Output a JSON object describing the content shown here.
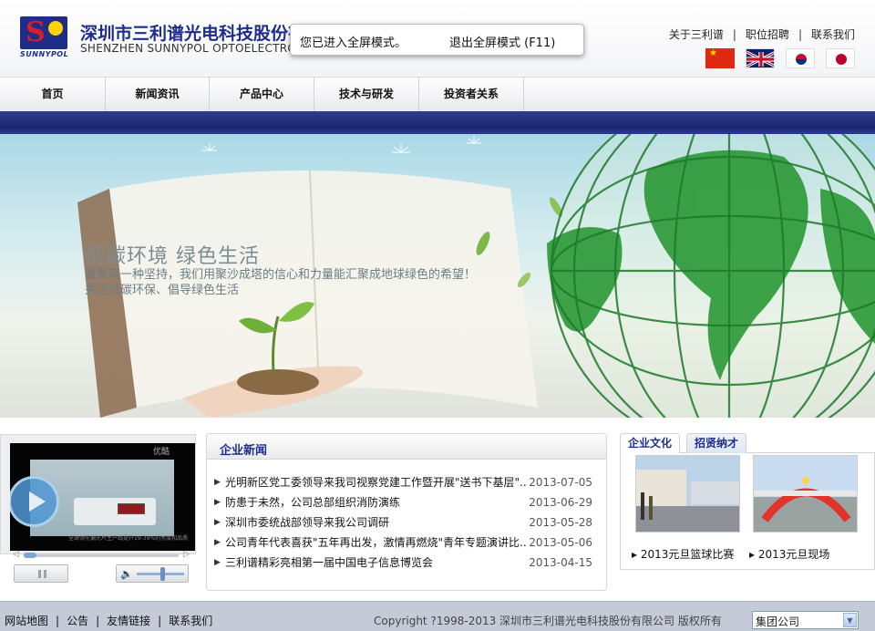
{
  "header": {
    "logo_text": "SUNNYPOL",
    "company_cn": "深圳市三利谱光电科技股份有",
    "company_en": "SHENZHEN SUNNYPOL OPTOELECTRON",
    "links": [
      "关于三利谱",
      "职位招聘",
      "联系我们"
    ],
    "flags": [
      "china-flag-icon",
      "uk-flag-icon",
      "korea-flag-icon",
      "japan-flag-icon"
    ]
  },
  "fullscreen_toast": {
    "message": "您已进入全屏模式。",
    "exit_label": "退出全屏模式 (F11)"
  },
  "nav": {
    "items": [
      "首页",
      "新闻资讯",
      "产品中心",
      "技术与研发",
      "投资者关系"
    ]
  },
  "banner": {
    "title": "低碳环境  绿色生活",
    "line1": "凝聚每一种坚持，我们用聚沙成塔的信心和力量能汇聚成地球绿色的希望！",
    "line2": "关注低碳环保、倡导绿色生活"
  },
  "video": {
    "brand": "优酷",
    "caption": "全球领先偏光片生产线提升19-39%的亮度和品质"
  },
  "news": {
    "title": "企业新闻",
    "items": [
      {
        "text": "光明新区党工委领导来我司视察党建工作暨开展\"送书下基层\"...",
        "date": "2013-07-05"
      },
      {
        "text": "防患于未然，公司总部组织消防演练",
        "date": "2013-06-29"
      },
      {
        "text": "深圳市委统战部领导来我公司调研",
        "date": "2013-05-28"
      },
      {
        "text": "公司青年代表喜获\"五年再出发，激情再燃烧\"青年专题演讲比...",
        "date": "2013-05-06"
      },
      {
        "text": "三利谱精彩亮相第一届中国电子信息博览会",
        "date": "2013-04-15"
      }
    ]
  },
  "culture": {
    "tabs": [
      "企业文化",
      "招贤纳才"
    ],
    "photos": [
      {
        "caption": "2013元旦篮球比赛"
      },
      {
        "caption": "2013元旦现场"
      }
    ]
  },
  "footer": {
    "links": [
      "网站地图",
      "公告",
      "友情链接",
      "联系我们"
    ],
    "copyright": "Copyright ?1998-2013 深圳市三利谱光电科技股份有限公司 版权所有",
    "group_select": "集团公司"
  },
  "colors": {
    "brand_blue": "#1f2d8a",
    "brand_red": "#d81e27",
    "footer_bg": "#c5cad8"
  }
}
